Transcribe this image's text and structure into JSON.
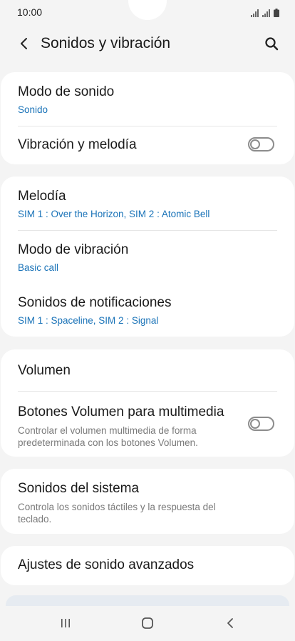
{
  "status": {
    "time": "10:00"
  },
  "header": {
    "title": "Sonidos y vibración"
  },
  "colors": {
    "accent": "#1a73b8",
    "background": "#f4f4f4",
    "card": "#ffffff"
  },
  "card1": {
    "modo_sonido": {
      "title": "Modo de sonido",
      "value": "Sonido"
    },
    "vibracion_melodia": {
      "title": "Vibración y melodía",
      "enabled": false
    }
  },
  "card2": {
    "melodia": {
      "title": "Melodía",
      "value": "SIM 1 : Over the Horizon, SIM 2 : Atomic Bell"
    },
    "modo_vibracion": {
      "title": "Modo de vibración",
      "value": "Basic call"
    },
    "sonidos_notificaciones": {
      "title": "Sonidos de notificaciones",
      "value": "SIM 1 : Spaceline, SIM 2 : Signal"
    }
  },
  "card3": {
    "volumen": {
      "title": "Volumen"
    },
    "botones_volumen": {
      "title": "Botones Volumen para multimedia",
      "desc_line1": "Controlar el volumen multimedia de forma",
      "desc_line2": "predeterminada con los botones Volumen.",
      "enabled": false
    }
  },
  "card4": {
    "sonidos_sistema": {
      "title": "Sonidos del sistema",
      "desc_line1": "Controla los sonidos táctiles y la respuesta del",
      "desc_line2": "teclado."
    }
  },
  "card5": {
    "ajustes_avanzados": {
      "title": "Ajustes de sonido avanzados"
    }
  },
  "icons": {
    "back": "back-arrow-icon",
    "search": "search-icon",
    "recents": "recents-icon",
    "home": "home-icon",
    "nav_back": "nav-back-icon"
  }
}
